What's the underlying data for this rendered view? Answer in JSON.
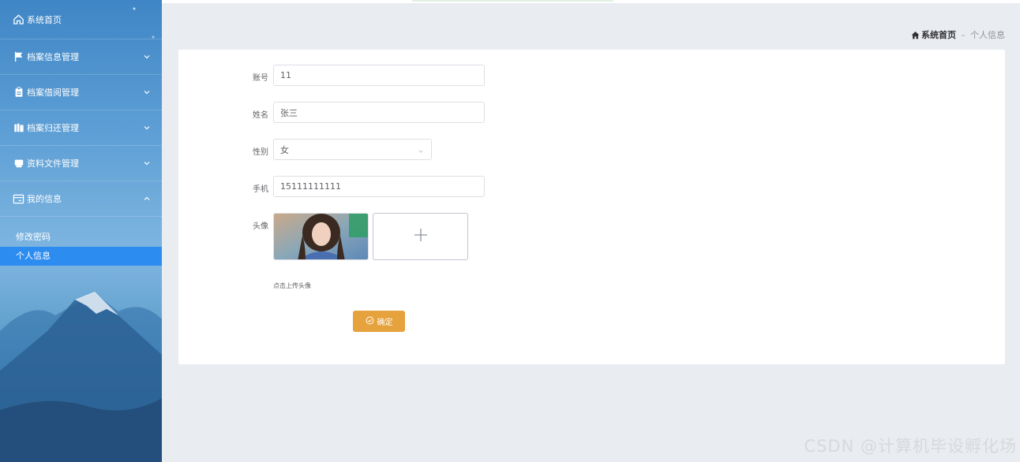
{
  "sidebar": {
    "items": [
      {
        "label": "系统首页",
        "icon": "home-icon"
      },
      {
        "label": "档案信息管理",
        "icon": "flag-icon",
        "expanded": false
      },
      {
        "label": "档案借阅管理",
        "icon": "clipboard-icon",
        "expanded": false
      },
      {
        "label": "档案归还管理",
        "icon": "books-icon",
        "expanded": false
      },
      {
        "label": "资料文件管理",
        "icon": "printer-icon",
        "expanded": false
      },
      {
        "label": "我的信息",
        "icon": "profile-card-icon",
        "expanded": true
      }
    ],
    "submenu": [
      {
        "label": "修改密码",
        "active": false
      },
      {
        "label": "个人信息",
        "active": true
      }
    ],
    "active_color": "#2d8cf0"
  },
  "breadcrumb": {
    "home": "系统首页",
    "separator": "-",
    "current": "个人信息"
  },
  "form": {
    "account": {
      "label": "账号",
      "value": "11"
    },
    "name": {
      "label": "姓名",
      "value": "张三"
    },
    "gender": {
      "label": "性别",
      "value": "女"
    },
    "phone": {
      "label": "手机",
      "value": "15111111111"
    },
    "avatar": {
      "label": "头像",
      "upload_tip": "点击上传头像"
    },
    "submit_label": "确定",
    "submit_color": "#e6a23c"
  },
  "watermark": "CSDN @计算机毕设孵化场"
}
